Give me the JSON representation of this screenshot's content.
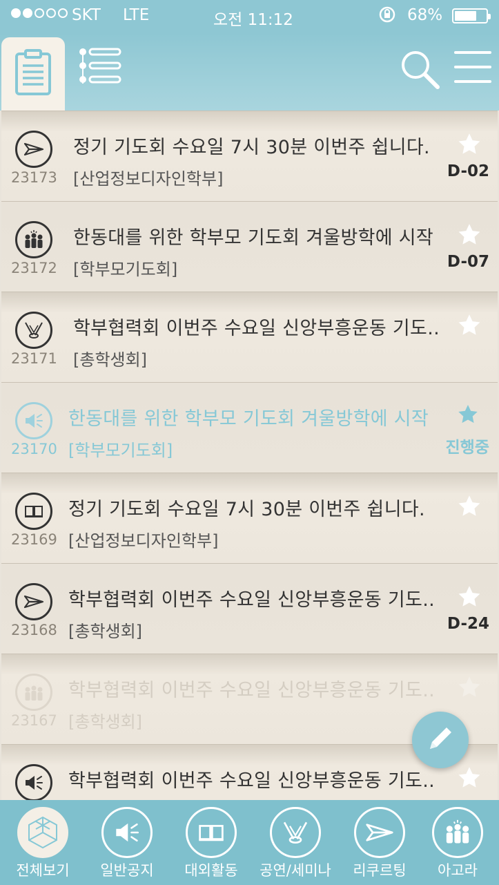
{
  "status_bar": {
    "carrier": "SKT",
    "network": "LTE",
    "time": "오전 11:12",
    "battery": "68%",
    "battery_level": 0.68,
    "signal_bars_filled": 2,
    "signal_bars_total": 5
  },
  "header": {
    "icons": [
      "clipboard-icon",
      "list-icon",
      "search-icon",
      "menu-icon"
    ]
  },
  "posts": [
    {
      "id": "23173",
      "icon": "paper-plane-icon",
      "title": "정기 기도회 수요일 7시 30분 이번주 쉽니다.",
      "category": "[산업정보디자인학부]",
      "badge": "D-02",
      "state": "normal"
    },
    {
      "id": "23172",
      "icon": "group-icon",
      "title": "한동대를 위한 학부모 기도회 겨울방학에 시작",
      "category": "[학부모기도회]",
      "badge": "D-07",
      "state": "normal"
    },
    {
      "id": "23171",
      "icon": "stage-icon",
      "title": "학부협력회 이번주 수요일 신앙부흥운동 기도..",
      "category": "[총학생회]",
      "badge": "",
      "state": "normal"
    },
    {
      "id": "23170",
      "icon": "megaphone-icon",
      "title": "한동대를 위한 학부모 기도회 겨울방학에 시작",
      "category": "[학부모기도회]",
      "badge": "진행중",
      "state": "highlight"
    },
    {
      "id": "23169",
      "icon": "book-icon",
      "title": "정기 기도회 수요일 7시 30분 이번주 쉽니다.",
      "category": "[산업정보디자인학부]",
      "badge": "",
      "state": "normal"
    },
    {
      "id": "23168",
      "icon": "paper-plane-icon",
      "title": "학부협력회 이번주 수요일 신앙부흥운동 기도..",
      "category": "[총학생회]",
      "badge": "D-24",
      "state": "normal"
    },
    {
      "id": "23167",
      "icon": "group-icon",
      "title": "학부협력회 이번주 수요일 신앙부흥운동 기도..",
      "category": "[총학생회]",
      "badge": "",
      "state": "faded"
    },
    {
      "id": "",
      "icon": "megaphone-icon",
      "title": "학부협력회 이번주 수요일 신앙부흥운동 기도..",
      "category": "",
      "badge": "",
      "state": "normal"
    }
  ],
  "fab": {
    "icon": "pencil-icon"
  },
  "tabs": [
    {
      "label": "전체보기",
      "icon": "cube-icon",
      "active": true
    },
    {
      "label": "일반공지",
      "icon": "megaphone-icon",
      "active": false
    },
    {
      "label": "대외활동",
      "icon": "book-icon",
      "active": false
    },
    {
      "label": "공연/세미나",
      "icon": "stage-icon",
      "active": false
    },
    {
      "label": "리쿠르팅",
      "icon": "paper-plane-icon",
      "active": false
    },
    {
      "label": "아고라",
      "icon": "group-icon",
      "active": false
    }
  ],
  "colors": {
    "accent": "#8ec7d3",
    "tabbar": "#7fc0cd",
    "list_bg": "#ece6dc",
    "highlight_text": "#86c8d6"
  }
}
